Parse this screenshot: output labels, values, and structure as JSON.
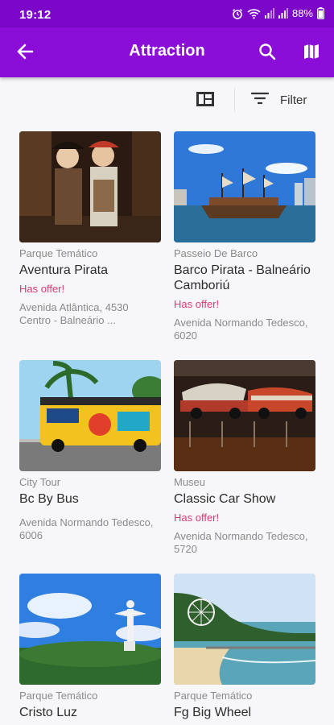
{
  "status_bar": {
    "time": "19:12",
    "battery": "88%",
    "icons": [
      "alarm-icon",
      "wifi-icon",
      "signal-icon",
      "signal-icon",
      "battery-icon"
    ]
  },
  "app_bar": {
    "title": "Attraction",
    "back_icon": "back-arrow-icon",
    "search_icon": "search-icon",
    "map_icon": "map-icon",
    "background": "#8a0ed8"
  },
  "toolbar": {
    "layout_icon": "grid-layout-icon",
    "filter_icon": "filter-icon",
    "filter_label": "Filter"
  },
  "colors": {
    "accent": "#8a0ed8",
    "offer": "#d83a78",
    "muted": "#8a8a8a"
  },
  "attractions": [
    {
      "category": "Parque Temático",
      "name": "Aventura Pirata",
      "offer": "Has offer!",
      "address": "Avenida Atlântica, 4530\nCentro - Balneário ..."
    },
    {
      "category": "Passeio De Barco",
      "name": "Barco Pirata - Balneário Camboriú",
      "offer": "Has offer!",
      "address": "Avenida Normando Tedesco, 6020"
    },
    {
      "category": "City Tour",
      "name": "Bc By Bus",
      "offer": "",
      "address": "Avenida Normando Tedesco, 6006"
    },
    {
      "category": "Museu",
      "name": "Classic Car Show",
      "offer": "Has offer!",
      "address": "Avenida Normando Tedesco, 5720"
    },
    {
      "category": "Parque Temático",
      "name": "Cristo Luz",
      "offer": "",
      "address": ""
    },
    {
      "category": "Parque Temático",
      "name": "Fg Big Wheel",
      "offer": "",
      "address": ""
    }
  ]
}
